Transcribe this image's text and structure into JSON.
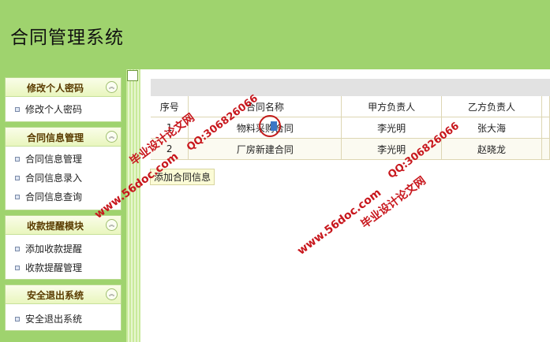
{
  "app": {
    "title": "合同管理系统"
  },
  "sidebar": {
    "panels": [
      {
        "title": "修改个人密码",
        "collapse_glyph": "︽",
        "items": [
          "修改个人密码"
        ]
      },
      {
        "title": "合同信息管理",
        "collapse_glyph": "︽",
        "items": [
          "合同信息管理",
          "合同信息录入",
          "合同信息查询"
        ]
      },
      {
        "title": "收款提醒模块",
        "collapse_glyph": "︽",
        "items": [
          "添加收款提醒",
          "收款提醒管理"
        ]
      },
      {
        "title": "安全退出系统",
        "collapse_glyph": "︽",
        "items": [
          "安全退出系统"
        ]
      }
    ]
  },
  "table": {
    "headers": [
      "序号",
      "合同名称",
      "甲方负责人",
      "乙方负责人"
    ],
    "rows": [
      [
        "1",
        "物料采购合同",
        "李光明",
        "张大海"
      ],
      [
        "2",
        "厂房新建合同",
        "李光明",
        "赵晓龙"
      ]
    ]
  },
  "actions": {
    "add_label": "添加合同信息"
  },
  "watermarks": {
    "site": "www.56doc.com",
    "qq": "QQ:306826066",
    "brand": "毕业设计论文网"
  },
  "colors": {
    "header_bg": "#9fd36e",
    "watermark": "#c8171d"
  }
}
